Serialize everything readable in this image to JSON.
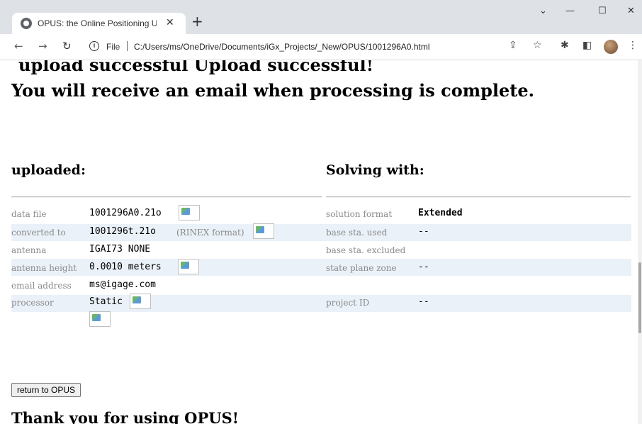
{
  "browser": {
    "tab_title": "OPUS: the Online Positioning Use",
    "tab_close": "✕",
    "new_tab": "+",
    "file_label": "File",
    "url": "C:/Users/ms/OneDrive/Documents/iGx_Projects/_New/OPUS/1001296A0.html",
    "icons": [
      "back-icon",
      "forward-icon",
      "reload-icon",
      "info-icon",
      "share-icon",
      "star-icon",
      "extensions-icon",
      "sidepanel-icon",
      "avatar",
      "menu-icon"
    ]
  },
  "page": {
    "upload_line": "upload successful Upload successful!",
    "email_line": "You will receive an email when processing is complete.",
    "left_heading": "uploaded:",
    "right_heading": "Solving with:",
    "left_rows": [
      {
        "label": "data file",
        "value": "1001296A0.21o",
        "note": ""
      },
      {
        "label": "converted to",
        "value": "1001296t.21o",
        "note": "(RINEX format)"
      },
      {
        "label": "antenna",
        "value": "IGAI73 NONE",
        "note": ""
      },
      {
        "label": "antenna height",
        "value": "0.0010 meters",
        "note": ""
      },
      {
        "label": "email address",
        "value": "ms@igage.com",
        "note": ""
      },
      {
        "label": "processor",
        "value": "Static",
        "note": ""
      }
    ],
    "right_rows": [
      {
        "label": "solution format",
        "value": "Extended"
      },
      {
        "label": "base sta. used",
        "value": "--"
      },
      {
        "label": "base sta. excluded",
        "value": ""
      },
      {
        "label": "state plane zone",
        "value": "--"
      },
      {
        "label": "",
        "value": ""
      },
      {
        "label": "project ID",
        "value": "--"
      }
    ],
    "return_button": "return to OPUS",
    "thanks": "Thank you for using OPUS!"
  }
}
